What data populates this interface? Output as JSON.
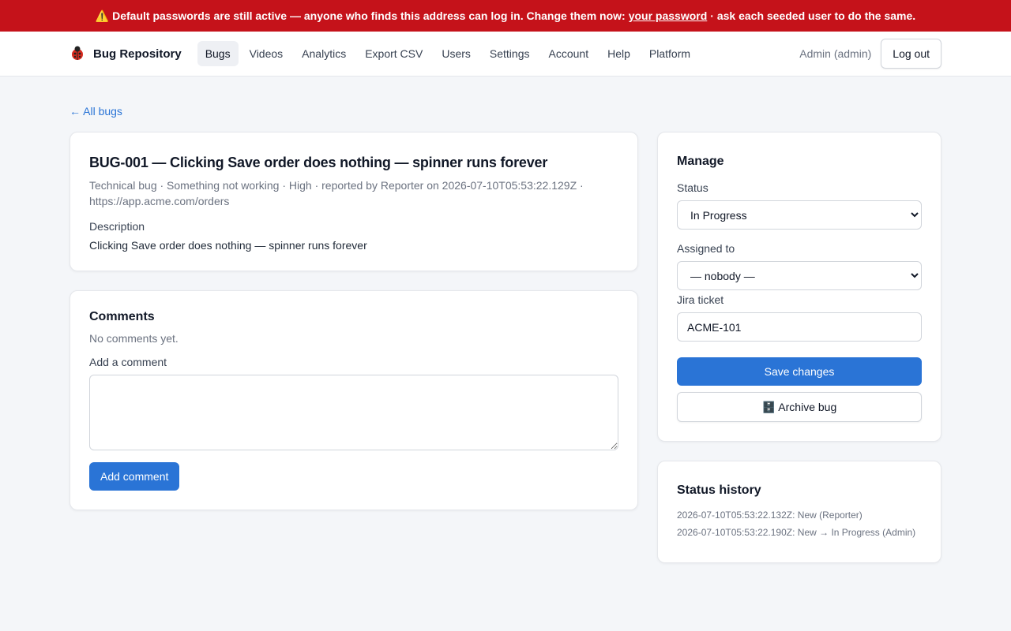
{
  "banner": {
    "icon": "warning-icon",
    "text": "⚠️ Default passwords are still active — anyone who finds this address can log in. Change them now:",
    "link_text": "your password",
    "suffix": "· ask each seeded user to do the same.",
    "bg_color": "#c5121a"
  },
  "nav": {
    "brand": "Bug Repository",
    "brand_icon": "ladybug-icon",
    "links": [
      "Bugs",
      "Videos",
      "Analytics",
      "Export CSV",
      "Users",
      "Settings",
      "Account",
      "Help",
      "Platform"
    ],
    "active": "Bugs",
    "user": "Admin (admin)",
    "logout": "Log out"
  },
  "back_link": "← All bugs",
  "bug": {
    "title": "BUG-001 — Clicking Save order does nothing — spinner runs forever",
    "meta": "Technical bug · Something not working · High · reported by Reporter on 2026-07-10T05:53:22.129Z · https://app.acme.com/orders",
    "description_label": "Description",
    "description": "Clicking Save order does nothing — spinner runs forever"
  },
  "comments": {
    "title": "Comments",
    "empty_text": "No comments yet.",
    "add_label": "Add a comment",
    "textarea_value": "",
    "submit_label": "Add comment"
  },
  "manage": {
    "title": "Manage",
    "status_label": "Status",
    "status_value": "In Progress",
    "assigned_label": "Assigned to",
    "assigned_value": "— nobody —",
    "jira_label": "Jira ticket",
    "jira_value": "ACME-101",
    "save_label": "Save changes",
    "archive_label": "🗄️ Archive bug",
    "accent_color": "#2a74d6"
  },
  "history": {
    "title": "Status history",
    "items": [
      "2026-07-10T05:53:22.132Z: New (Reporter)",
      "2026-07-10T05:53:22.190Z: New → In Progress (Admin)"
    ]
  }
}
